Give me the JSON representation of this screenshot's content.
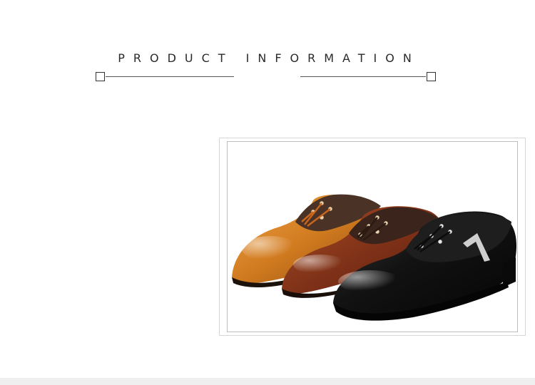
{
  "header": {
    "title": "PRODUCT INFORMATION"
  },
  "product_image": {
    "icon": "oxford-dress-shoes-photo",
    "shoes": [
      {
        "color_name": "tan",
        "upper": "#d07a1f",
        "accent": "#5a3418"
      },
      {
        "color_name": "brown",
        "upper": "#7a2e16",
        "accent": "#3a241c"
      },
      {
        "color_name": "black",
        "upper": "#121212",
        "accent": "#202020"
      }
    ]
  },
  "colors": {
    "rule": "#555555",
    "frame_outer": "#d6d6d6",
    "frame_inner": "#bdbdbd",
    "bottom_band": "#efefef"
  }
}
